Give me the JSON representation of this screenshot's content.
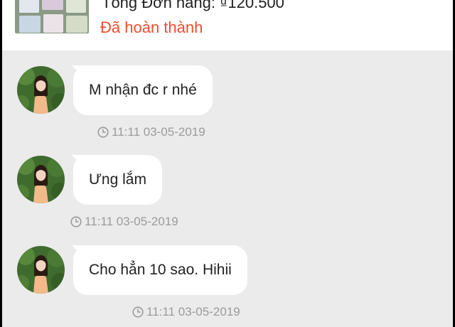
{
  "order": {
    "total": "Tổng Đơn hàng: ₫120.500",
    "status": "Đã hoàn thành",
    "status_color": "#ee4d2d"
  },
  "messages": [
    {
      "text": "M nhận đc r nhé",
      "time": "11:11 03-05-2019"
    },
    {
      "text": "Ưng lắm",
      "time": "11:11 03-05-2019"
    },
    {
      "text": "Cho hẳn 10 sao. Hihii",
      "time": "11:11 03-05-2019"
    }
  ],
  "icons": {
    "timestamp": "clock-icon",
    "avatar": "avatar"
  },
  "colors": {
    "chat_background": "#ebebeb",
    "bubble": "#ffffff",
    "text": "#222222",
    "timestamp": "#9b9b9b"
  }
}
